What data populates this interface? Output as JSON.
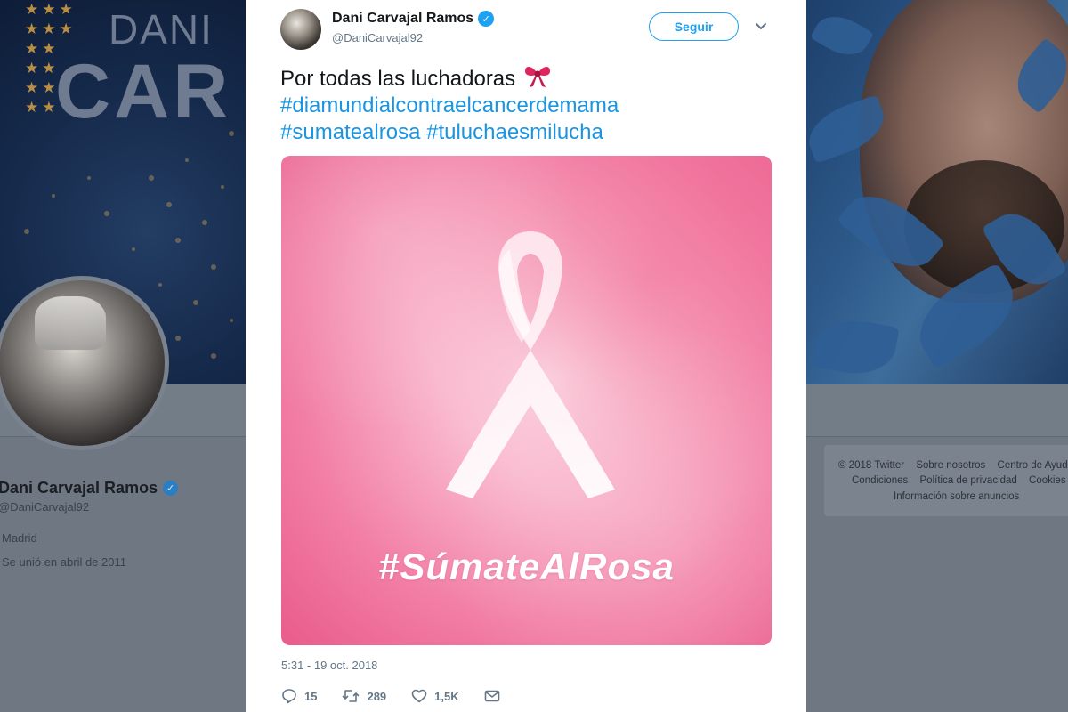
{
  "background_profile": {
    "banner_name_small": "DANI",
    "banner_name_big": "CAR",
    "name": "Dani Carvajal Ramos",
    "handle": "@DaniCarvajal92",
    "location": "Madrid",
    "joined": "Se unió en abril de 2011",
    "footer": {
      "row1": [
        "© 2018 Twitter",
        "Sobre nosotros",
        "Centro de Ayuda"
      ],
      "row2": [
        "Condiciones",
        "Política de privacidad",
        "Cookies"
      ],
      "row3": "Información sobre anuncios"
    }
  },
  "tweet": {
    "author_name": "Dani Carvajal Ramos",
    "author_handle": "@DaniCarvajal92",
    "follow_label": "Seguir",
    "text_line1": "Por todas las luchadoras",
    "hashtag_line2": "#diamundialcontraelcancerdemama",
    "hashtag_line3a": "#sumatealrosa",
    "hashtag_line3b": "#tuluchaesmilucha",
    "image_caption": "#SúmateAlRosa",
    "timestamp": "5:31 - 19 oct. 2018",
    "replies": "15",
    "retweets": "289",
    "likes": "1,5K"
  },
  "colors": {
    "link": "#1b95e0",
    "verified": "#1da1f2",
    "image_pink": "#f27fa6"
  },
  "icons": [
    "verified-icon",
    "chevron-down-icon",
    "ribbon-emoji-icon",
    "reply-icon",
    "retweet-icon",
    "like-icon",
    "direct-message-icon"
  ]
}
